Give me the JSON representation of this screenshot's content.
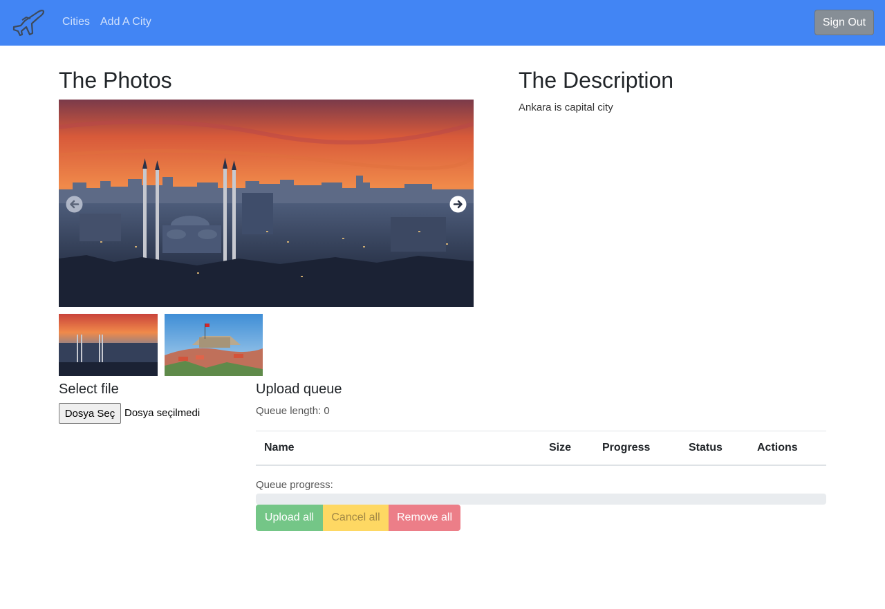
{
  "navbar": {
    "brand_icon": "airplane-icon",
    "links": [
      {
        "label": "Cities"
      },
      {
        "label": "Add A City"
      }
    ],
    "signout_label": "Sign Out",
    "background": "#4285f4"
  },
  "photos": {
    "title": "The Photos",
    "carousel": {
      "prev_icon": "arrow-left-circle-icon",
      "next_icon": "arrow-right-circle-icon"
    },
    "thumbnails": [
      "ankara-skyline-sunset",
      "ankara-castle-flag"
    ]
  },
  "description": {
    "title": "The Description",
    "text": "Ankara is capital city"
  },
  "select_file": {
    "title": "Select file",
    "button_label": "Dosya Seç",
    "status": "Dosya seçilmedi"
  },
  "upload_queue": {
    "title": "Upload queue",
    "length_text": "Queue length: 0",
    "columns": [
      "Name",
      "Size",
      "Progress",
      "Status",
      "Actions"
    ],
    "progress_label": "Queue progress:",
    "progress_value": 0,
    "buttons": {
      "upload": "Upload all",
      "cancel": "Cancel all",
      "remove": "Remove all"
    }
  }
}
